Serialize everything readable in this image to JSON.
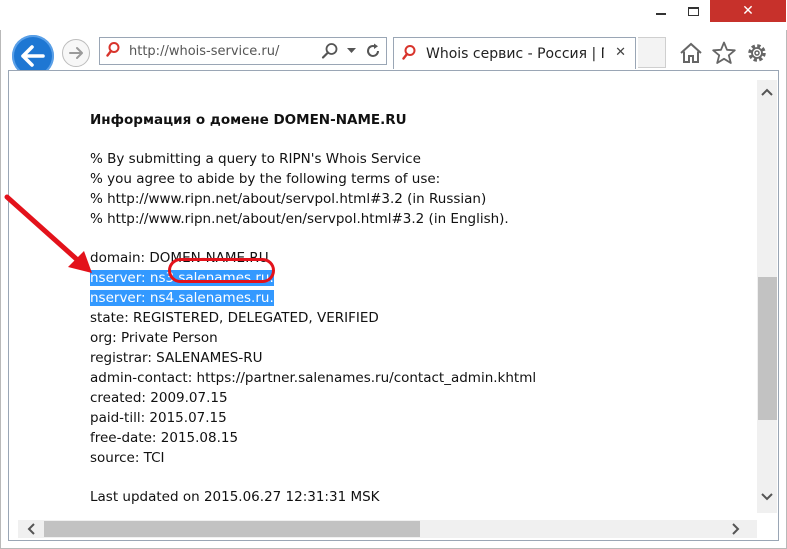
{
  "browser": {
    "address_url": "http://whois-service.ru/",
    "tab_title": "Whois сервис - Россия | П...",
    "tab_close": "✕",
    "window_close": "✕"
  },
  "whois": {
    "heading": "Информация о домене DOMEN-NAME.RU",
    "terms": [
      "% By submitting a query to RIPN's Whois Service",
      "% you agree to abide by the following terms of use:",
      "% http://www.ripn.net/about/servpol.html#3.2 (in Russian)",
      "% http://www.ripn.net/about/en/servpol.html#3.2 (in English)."
    ],
    "domain": "domain: DOMEN-NAME.RU",
    "nserver1": "nserver: ns3.salenames.ru.",
    "nserver2": "nserver: ns4.salenames.ru.",
    "records": [
      "state: REGISTERED, DELEGATED, VERIFIED",
      "org: Private Person",
      "registrar: SALENAMES-RU",
      "admin-contact: https://partner.salenames.ru/contact_admin.khtml",
      "created: 2009.07.15",
      "paid-till: 2015.07.15",
      "free-date: 2015.08.15",
      "source: TCI"
    ],
    "last_updated": "Last updated on 2015.06.27 12:31:31 MSK"
  },
  "colors": {
    "selection": "#3399ff",
    "annotation": "#e3121b",
    "back_button": "#1e77d3"
  }
}
